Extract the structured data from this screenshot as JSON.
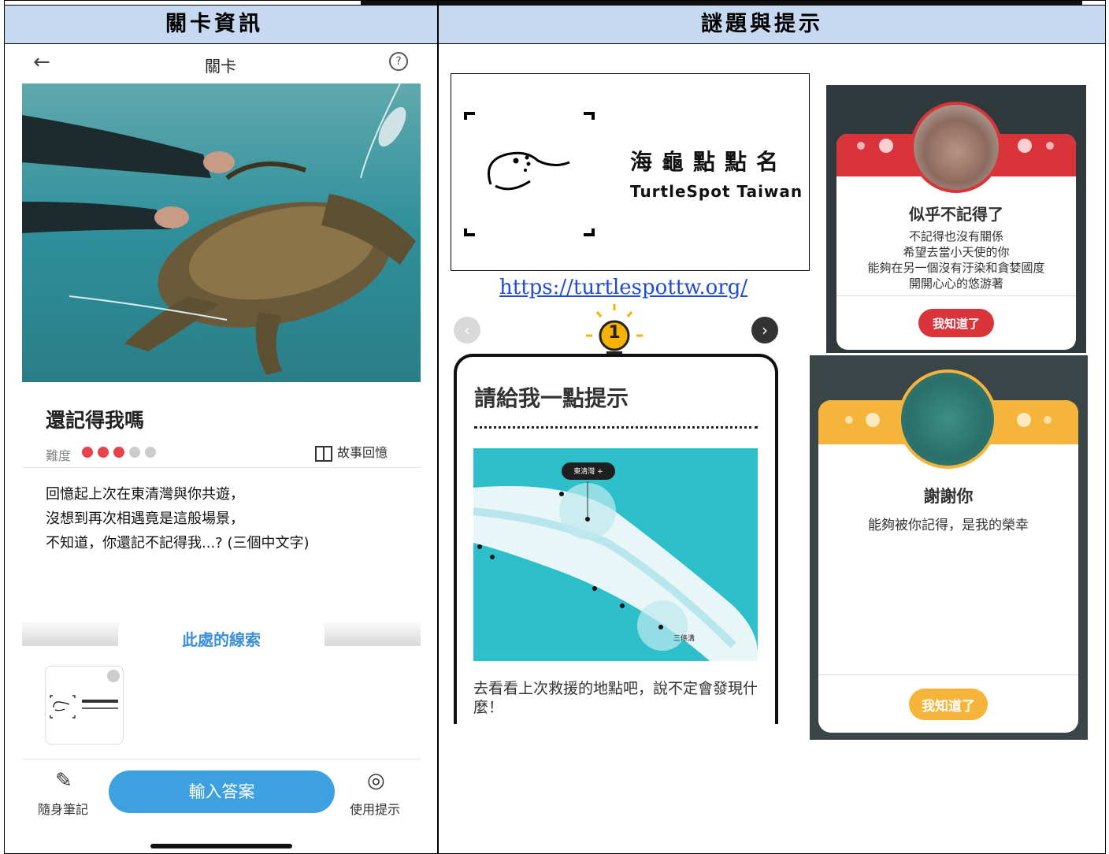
{
  "headers": {
    "left": "關卡資訊",
    "right": "謎題與提示"
  },
  "phone": {
    "nav_title": "關卡",
    "back_icon": "←",
    "help_icon": "?",
    "level_title": "還記得我嗎",
    "difficulty_label": "難度",
    "difficulty": {
      "level": 3,
      "max": 5,
      "active_color": "#e8424b",
      "inactive_color": "#cccccc"
    },
    "story_label": "故事回憶",
    "description": [
      "回憶起上次在東清灣與你共遊，",
      "沒想到再次相遇竟是這般場景，",
      "不知道，你還記不記得我...? (三個中文字)"
    ],
    "clue_title": "此處的線索",
    "bottom_bar": {
      "notes_label": "隨身筆記",
      "answer_label": "輸入答案",
      "hint_label": "使用提示"
    }
  },
  "logo": {
    "cn": "海龜點點名",
    "en": "TurtleSpot Taiwan"
  },
  "url": "https://turtlespottw.org/",
  "hint": {
    "number": "1",
    "title": "請給我一點提示",
    "map_labels": {
      "top": "東清灣 +",
      "bottom": "三條溝"
    },
    "text": "去看看上次救援的地點吧，說不定會發現什麼！"
  },
  "modal_forgot": {
    "title": "似乎不記得了",
    "body": [
      "不記得也沒有關係",
      "希望去當小天使的你",
      "能夠在另一個沒有汙染和貪婪國度",
      "開開心心的悠游著"
    ],
    "button": "我知道了",
    "color": "#d8343a"
  },
  "modal_thanks": {
    "title": "謝謝你",
    "body": "能夠被你記得，是我的榮幸",
    "button": "我知道了",
    "color": "#f6b43a"
  }
}
